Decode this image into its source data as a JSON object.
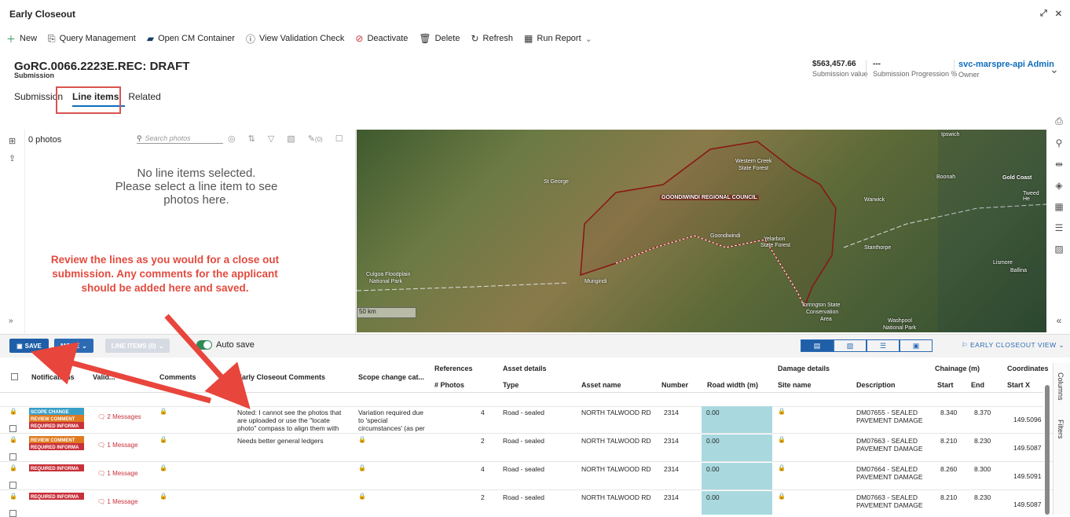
{
  "window": {
    "title": "Early Closeout"
  },
  "commands": [
    {
      "icon": "plus-icon",
      "label": "New"
    },
    {
      "icon": "query-icon",
      "label": "Query Management"
    },
    {
      "icon": "container-icon",
      "label": "Open CM Container"
    },
    {
      "icon": "info-icon",
      "label": "View Validation Check"
    },
    {
      "icon": "deactivate-icon",
      "label": "Deactivate"
    },
    {
      "icon": "delete-icon",
      "label": "Delete"
    },
    {
      "icon": "refresh-icon",
      "label": "Refresh"
    },
    {
      "icon": "report-icon",
      "label": "Run Report"
    }
  ],
  "record": {
    "title": "GoRC.0066.2223E.REC: DRAFT",
    "type": "Submission"
  },
  "header_fields": [
    {
      "value": "$563,457.66",
      "label": "Submission value"
    },
    {
      "value": "---",
      "label": "Submission Progression %"
    },
    {
      "value": "svc-marspre-api Admin",
      "label": "Owner"
    }
  ],
  "tabs": [
    "Submission",
    "Line items",
    "Related"
  ],
  "photos": {
    "count_label": "0 photos",
    "search_placeholder": "Search photos",
    "attach_count": "(0)"
  },
  "empty_message": [
    "No line items selected.",
    "Please select a line item to see",
    "photos here."
  ],
  "annotation_note": [
    "Review the lines as you would for a close out",
    "submission.  Any comments for the applicant",
    "should be added here and saved."
  ],
  "map": {
    "labels": [
      "Ipswich",
      "Western Creek",
      "State Forest",
      "St George",
      "GOONDIWINDI REGIONAL COUNCIL",
      "Boonah",
      "Gold Coast",
      "Tweed He",
      "Warwick",
      "Goondiwindi",
      "Yelarbon",
      "State Forest",
      "Stanthorpe",
      "Culgoa Floodplain",
      "National Park",
      "Mungindi",
      "Lismore",
      "Ballina",
      "Torrington State",
      "Conservation",
      "Area",
      "Washpool",
      "National Park"
    ],
    "scale": "50 km"
  },
  "toolbar": {
    "save": "SAVE",
    "more": "MORE",
    "line_items": "LINE ITEMS (0)",
    "auto_save": "Auto save",
    "view_name": "EARLY CLOSEOUT VIEW"
  },
  "columns": {
    "notifications": "Notifications",
    "validation": "Valid...",
    "comments": "Comments",
    "ec_comments": "Early Closeout Comments",
    "scope": "Scope change cat...",
    "references": "References",
    "photos": "# Photos",
    "asset_details": "Asset details",
    "type": "Type",
    "asset_name": "Asset name",
    "number": "Number",
    "road_width": "Road width (m)",
    "damage_details": "Damage details",
    "site_name": "Site name",
    "description": "Description",
    "chainage": "Chainage (m)",
    "start": "Start",
    "end": "End",
    "coordinates": "Coordinates",
    "start_x": "Start X"
  },
  "rows": [
    {
      "badges": [
        "SCOPE CHANGE",
        "REVIEW COMMENT",
        "REQUIRED INFORMA"
      ],
      "messages": "2 Messages",
      "ec_comment": "Noted:  I cannot see the photos that are uploaded or use the \"locate photo\" compass to align them with",
      "scope": "Variation required due to 'special circumstances' (as per",
      "photos": "4",
      "type": "Road - sealed",
      "asset": "NORTH TALWOOD RD",
      "number": "2314",
      "width": "0.00",
      "desc": "DM07655 - SEALED PAVEMENT DAMAGE",
      "start": "8.340",
      "end": "8.370",
      "x": "149.509632"
    },
    {
      "badges": [
        "REVIEW COMMENT",
        "REQUIRED INFORMA"
      ],
      "messages": "1 Message",
      "ec_comment": "Needs better general ledgers",
      "scope": "",
      "photos": "2",
      "type": "Road - sealed",
      "asset": "NORTH TALWOOD RD",
      "number": "2314",
      "width": "0.00",
      "desc": "DM07663 - SEALED PAVEMENT DAMAGE",
      "start": "8.210",
      "end": "8.230",
      "x": "149.508769"
    },
    {
      "badges": [
        "REQUIRED INFORMA"
      ],
      "messages": "1 Message",
      "ec_comment": "",
      "scope": "",
      "photos": "4",
      "type": "Road - sealed",
      "asset": "NORTH TALWOOD RD",
      "number": "2314",
      "width": "0.00",
      "desc": "DM07664 - SEALED PAVEMENT DAMAGE",
      "start": "8.260",
      "end": "8.300",
      "x": "149.509102"
    },
    {
      "badges": [
        "REQUIRED INFORMA"
      ],
      "messages": "1 Message",
      "ec_comment": "",
      "scope": "",
      "photos": "2",
      "type": "Road - sealed",
      "asset": "NORTH TALWOOD RD",
      "number": "2314",
      "width": "0.00",
      "desc": "DM07663 - SEALED PAVEMENT DAMAGE",
      "start": "8.210",
      "end": "8.230",
      "x": "149.508769"
    }
  ],
  "side_tabs": [
    "Columns",
    "Filters"
  ]
}
